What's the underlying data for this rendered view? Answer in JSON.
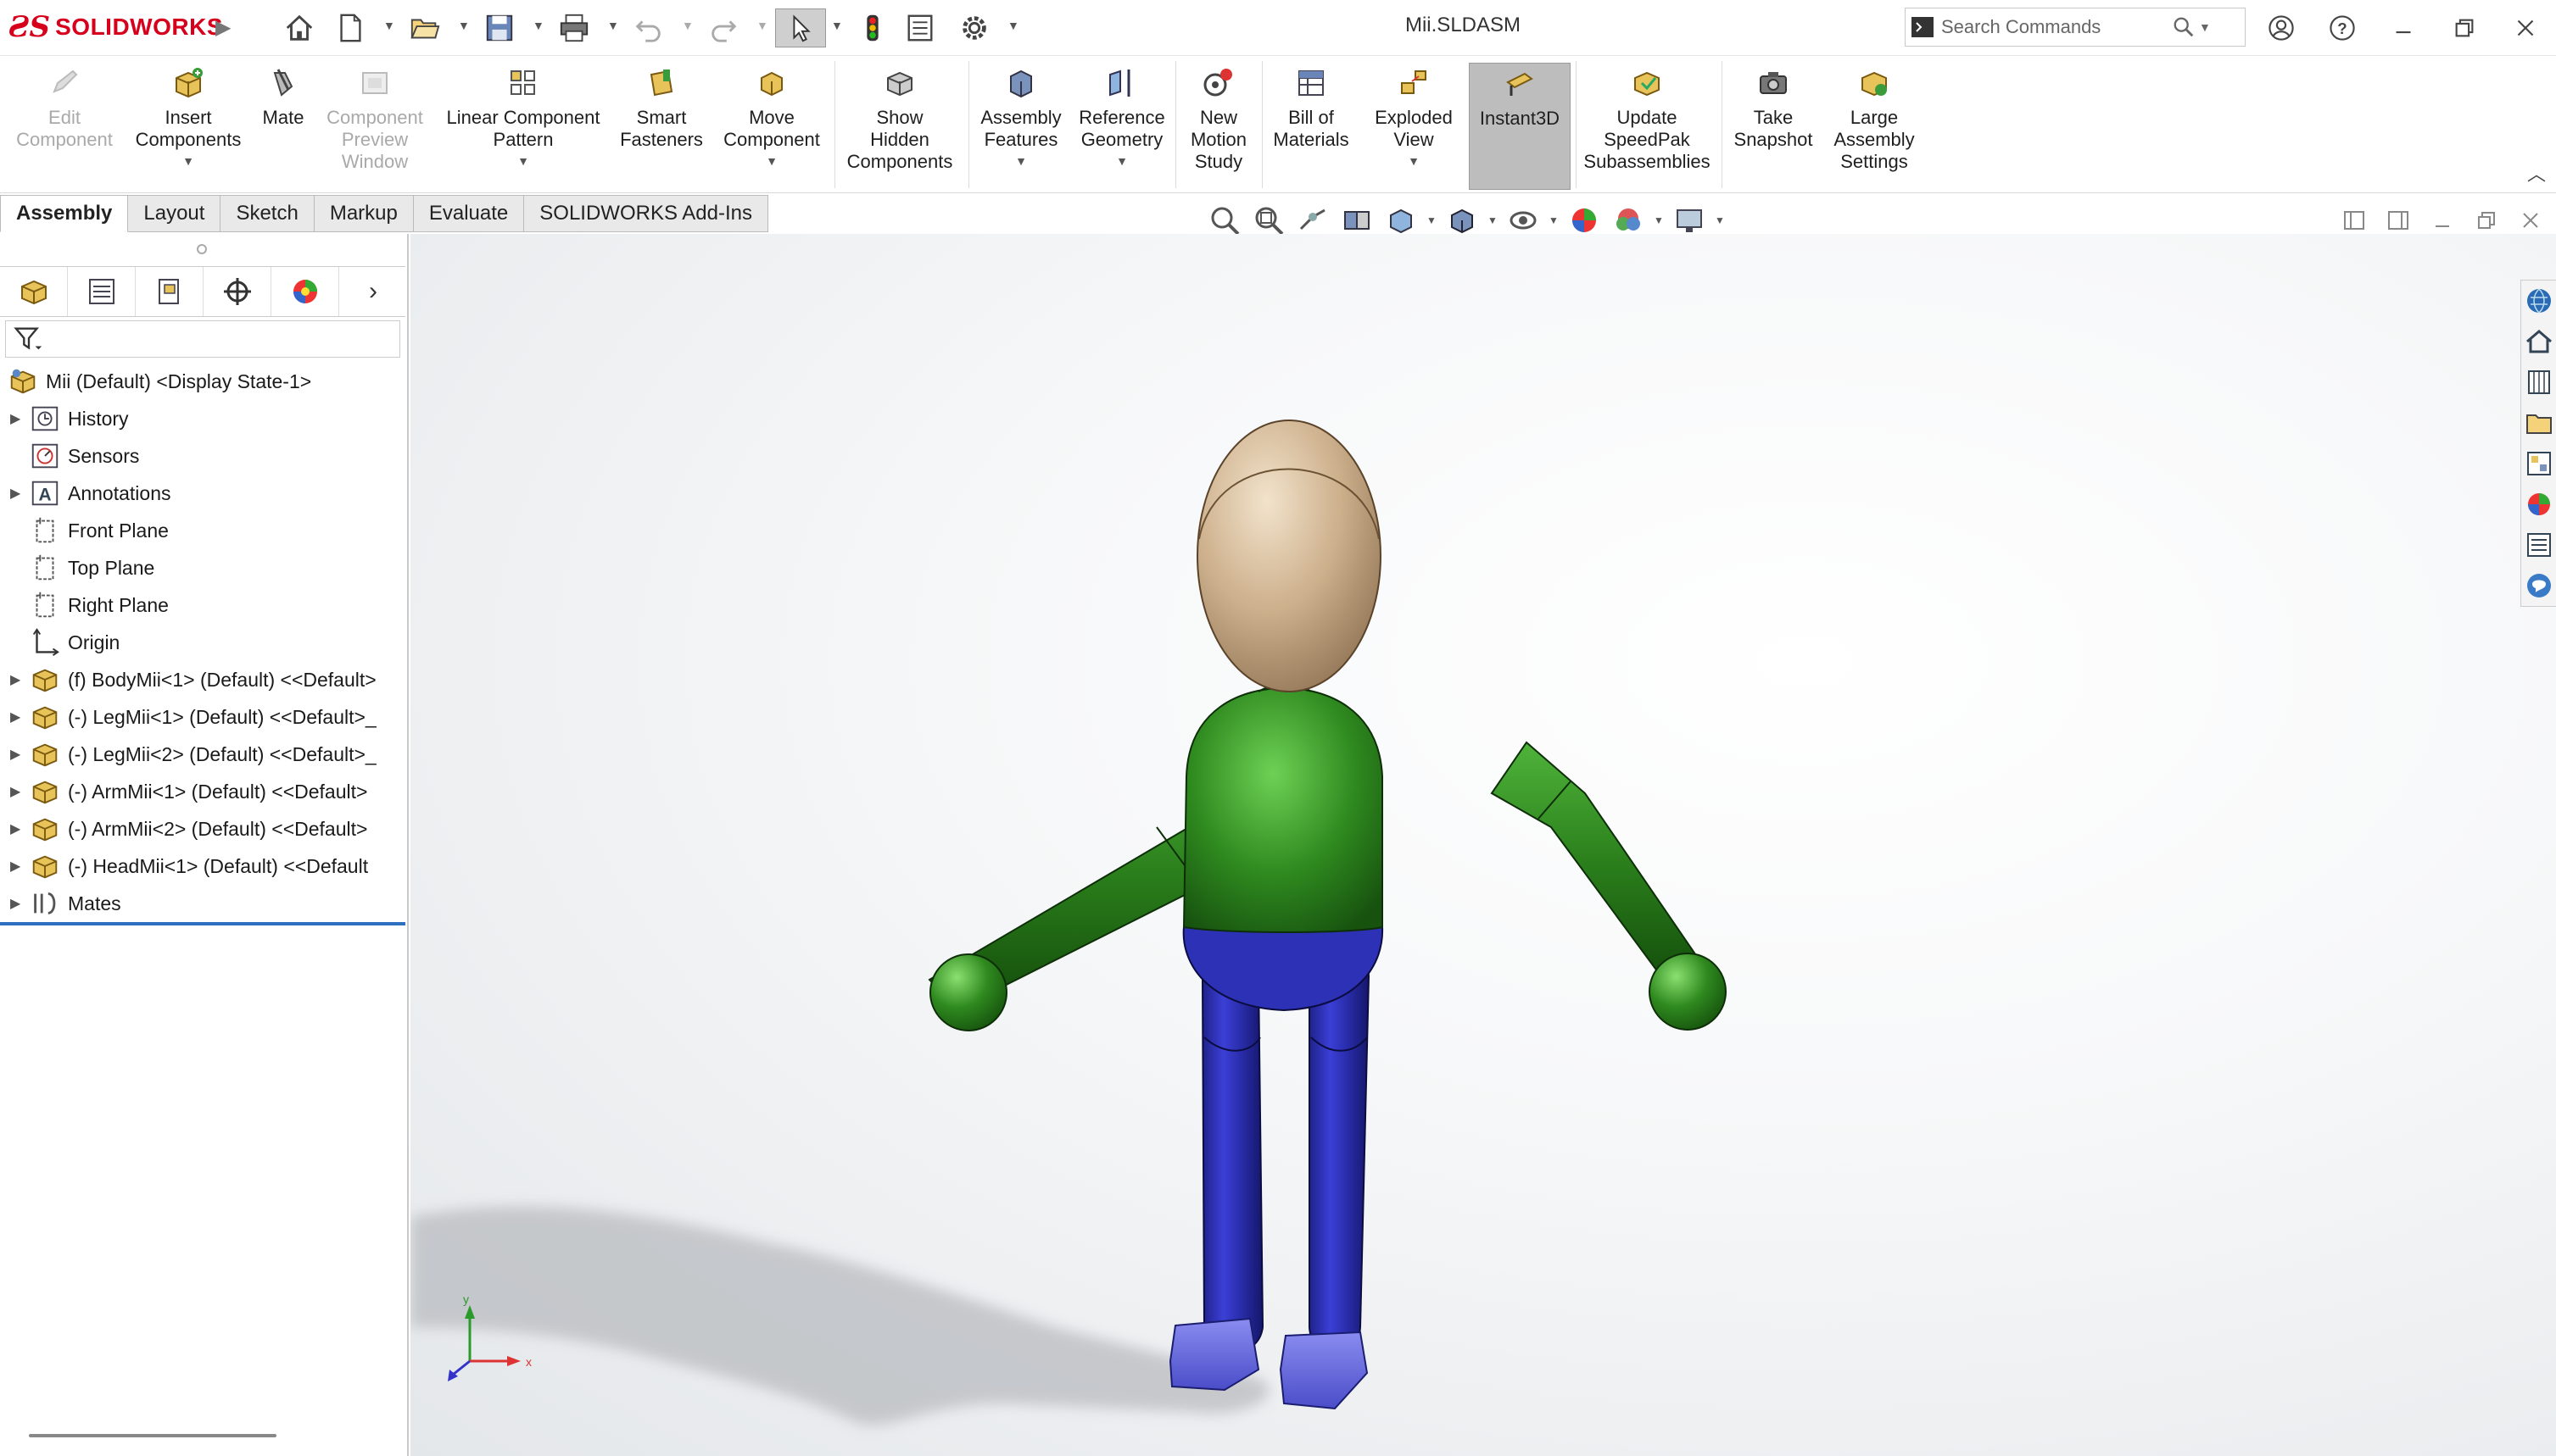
{
  "app": {
    "brand": "SOLIDWORKS",
    "document_title": "Mii.SLDASM"
  },
  "quick_access": [
    "home-icon",
    "new-document-icon",
    "open-icon",
    "save-icon",
    "print-icon",
    "undo-icon",
    "redo-icon",
    "select-icon",
    "rebuild-icon",
    "file-properties-icon",
    "options-icon"
  ],
  "search": {
    "placeholder": "Search Commands"
  },
  "command_manager": {
    "items": [
      {
        "label": "Edit\nComponent",
        "enabled": false
      },
      {
        "label": "Insert\nComponents",
        "enabled": true
      },
      {
        "label": "Mate",
        "enabled": true
      },
      {
        "label": "Component\nPreview\nWindow",
        "enabled": false
      },
      {
        "label": "Linear Component\nPattern",
        "enabled": true
      },
      {
        "label": "Smart\nFasteners",
        "enabled": true
      },
      {
        "label": "Move\nComponent",
        "enabled": true
      },
      {
        "label": "Show\nHidden\nComponents",
        "enabled": true
      },
      {
        "label": "Assembly\nFeatures",
        "enabled": true
      },
      {
        "label": "Reference\nGeometry",
        "enabled": true
      },
      {
        "label": "New\nMotion\nStudy",
        "enabled": true
      },
      {
        "label": "Bill of\nMaterials",
        "enabled": true
      },
      {
        "label": "Exploded\nView",
        "enabled": true
      },
      {
        "label": "Instant3D",
        "enabled": true,
        "active": true
      },
      {
        "label": "Update\nSpeedPak\nSubassemblies",
        "enabled": true
      },
      {
        "label": "Take\nSnapshot",
        "enabled": true
      },
      {
        "label": "Large\nAssembly\nSettings",
        "enabled": true
      }
    ]
  },
  "tabs": [
    {
      "label": "Assembly",
      "active": true
    },
    {
      "label": "Layout"
    },
    {
      "label": "Sketch"
    },
    {
      "label": "Markup"
    },
    {
      "label": "Evaluate"
    },
    {
      "label": "SOLIDWORKS Add-Ins"
    }
  ],
  "feature_tree": {
    "root": "Mii (Default) <Display State-1>",
    "nodes": [
      {
        "label": "History",
        "icon": "history-icon",
        "expandable": true
      },
      {
        "label": "Sensors",
        "icon": "sensors-icon",
        "expandable": false
      },
      {
        "label": "Annotations",
        "icon": "annotations-icon",
        "expandable": true
      },
      {
        "label": "Front Plane",
        "icon": "plane-icon",
        "expandable": false
      },
      {
        "label": "Top Plane",
        "icon": "plane-icon",
        "expandable": false
      },
      {
        "label": "Right Plane",
        "icon": "plane-icon",
        "expandable": false
      },
      {
        "label": "Origin",
        "icon": "origin-icon",
        "expandable": false
      },
      {
        "label": "(f) BodyMii<1> (Default) <<Default>",
        "icon": "part-icon",
        "expandable": true
      },
      {
        "label": "(-) LegMii<1> (Default) <<Default>_",
        "icon": "part-icon",
        "expandable": true
      },
      {
        "label": "(-) LegMii<2> (Default) <<Default>_",
        "icon": "part-icon",
        "expandable": true
      },
      {
        "label": "(-) ArmMii<1> (Default) <<Default>",
        "icon": "part-icon",
        "expandable": true
      },
      {
        "label": "(-) ArmMii<2> (Default) <<Default>",
        "icon": "part-icon",
        "expandable": true
      },
      {
        "label": "(-) HeadMii<1> (Default) <<Default",
        "icon": "part-icon",
        "expandable": true
      },
      {
        "label": "Mates",
        "icon": "mates-icon",
        "expandable": true
      }
    ]
  },
  "colors": {
    "brand": "#d6001c",
    "body": "#2f8a1f",
    "legs": "#2b2fb0",
    "head": "#c9ad8a",
    "selection_line": "#2e6fc2"
  }
}
